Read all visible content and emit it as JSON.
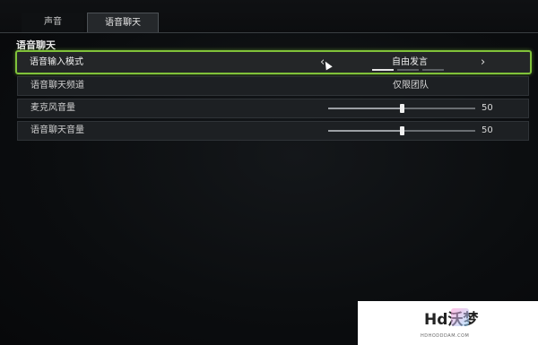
{
  "tabs": [
    {
      "label": "声音",
      "active": false
    },
    {
      "label": "语音聊天",
      "active": true
    }
  ],
  "section_title": "语音聊天",
  "rows": {
    "input_mode": {
      "label": "语音输入模式",
      "value": "自由发言",
      "options_count": 3,
      "active_option": 0
    },
    "channel": {
      "label": "语音聊天频道",
      "value": "仅限团队"
    },
    "mic_volume": {
      "label": "麦克风音量",
      "value": 50,
      "display": "50",
      "min": 0,
      "max": 100
    },
    "chat_volume": {
      "label": "语音聊天音量",
      "value": 50,
      "display": "50",
      "min": 0,
      "max": 100
    }
  },
  "icons": {
    "prev": "chevron-left-icon",
    "next": "chevron-right-icon"
  },
  "colors": {
    "accent": "#80c23a",
    "background": "#0b0d0f"
  },
  "watermark": {
    "logo": "Hd沃梦",
    "sub": "HDHODDDAM.COM"
  }
}
